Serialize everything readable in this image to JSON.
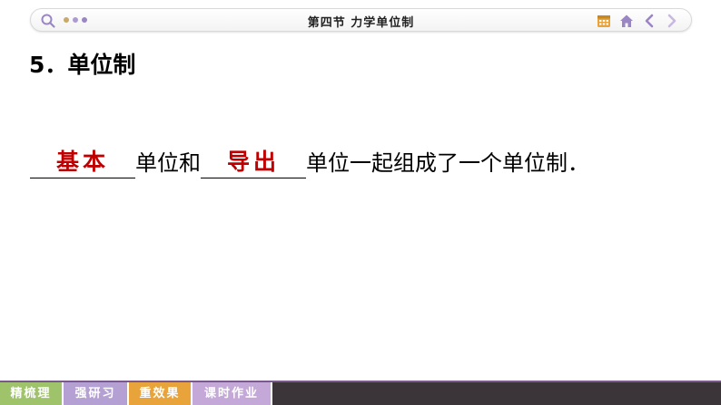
{
  "header": {
    "title": "第四节  力学单位制",
    "icons": [
      "search-icon",
      "more-dots-icon",
      "calendar-icon",
      "home-icon",
      "prev-arrow-icon",
      "next-arrow-icon"
    ]
  },
  "content": {
    "heading": "5．单位制",
    "blank1_answer": "基本",
    "text1": "单位和",
    "blank2_answer": "导出",
    "text2": "单位一起组成了一个单位制．"
  },
  "footer": {
    "tabs": [
      {
        "label": "精梳理",
        "color": "#9ec36a"
      },
      {
        "label": "强研习",
        "color": "#b4a0d2"
      },
      {
        "label": "重效果",
        "color": "#e8a43a"
      },
      {
        "label": "课时作业",
        "color": "#c4a9d8"
      }
    ]
  },
  "colors": {
    "answer": "#c00000",
    "icon_purple": "#9b86c4",
    "icon_orange": "#e8a43a"
  }
}
